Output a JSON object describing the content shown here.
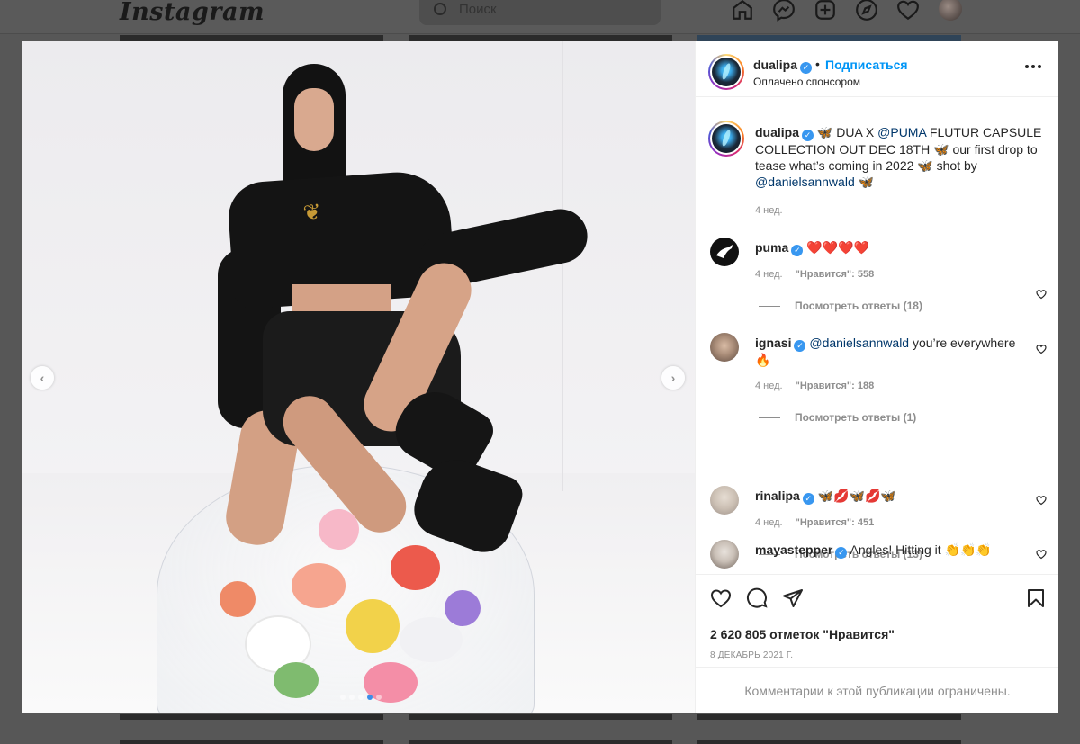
{
  "background": {
    "logo": "Instagram",
    "search_placeholder": "Поиск"
  },
  "post": {
    "username": "dualipa",
    "follow_label": "Подписаться",
    "sponsored": "Оплачено спонсором",
    "caption": {
      "username": "dualipa",
      "text_1": " DUA X ",
      "mention_1": "@PUMA",
      "text_2": " FLUTUR CAPSULE COLLECTION OUT DEC 18TH ",
      "text_3": " our first drop to tease what’s coming in 2022 ",
      "text_4": " shot by ",
      "mention_2": "@danielsannwald",
      "age": "4 нед."
    },
    "comments": [
      {
        "username": "puma",
        "text": "❤️❤️❤️❤️",
        "age": "4 нед.",
        "likes": "\"Нравится\": 558",
        "replies": "Посмотреть ответы (18)"
      },
      {
        "username": "ignasi",
        "mention": "@danielsannwald",
        "text": " you’re everywhere 🔥",
        "age": "4 нед.",
        "likes": "\"Нравится\": 188",
        "replies": "Посмотреть ответы (1)"
      },
      {
        "username": "rinalipa",
        "text": "🦋💋🦋💋🦋",
        "age": "4 нед.",
        "likes": "\"Нравится\": 451",
        "replies": "Посмотреть ответы (13)"
      },
      {
        "username": "mayastepper",
        "text": "Angles! Hitting it 👏👏👏"
      }
    ],
    "likes_count": "2 620 805 отметок \"Нравится\"",
    "date": "8 ДЕКАБРЬ 2021 Г.",
    "comments_restricted": "Комментарии к этой публикации ограничены."
  },
  "carousel": {
    "total": 5,
    "active": 4
  },
  "icons": [
    "home-icon",
    "messenger-icon",
    "new-post-icon",
    "explore-icon",
    "activity-icon",
    "heart-icon",
    "comment-icon",
    "share-icon",
    "save-icon",
    "more-icon",
    "chevron-left-icon",
    "chevron-right-icon",
    "verified-icon",
    "butterfly-emoji"
  ],
  "colors": {
    "accent": "#0095f6",
    "verified": "#3897f0",
    "like_red": "#ed4956",
    "mention": "#00376b"
  }
}
